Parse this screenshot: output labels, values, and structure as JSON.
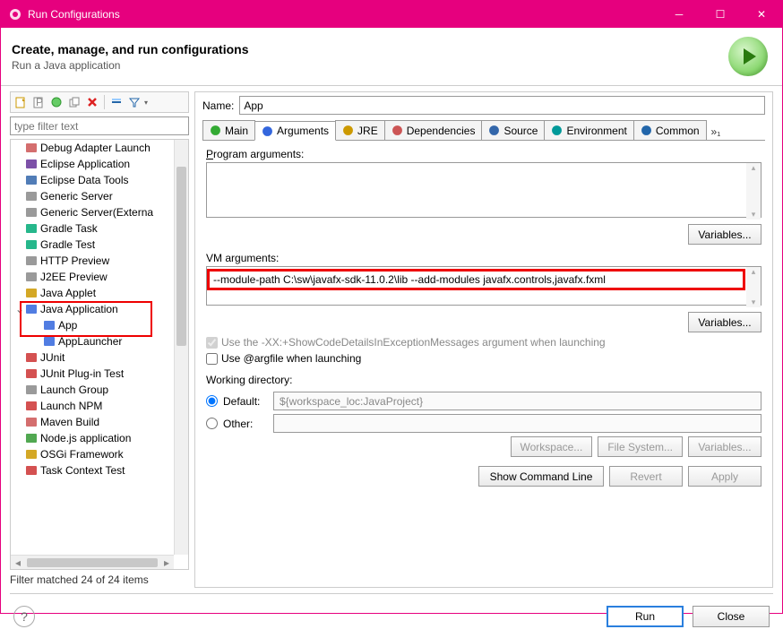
{
  "window": {
    "title": "Run Configurations"
  },
  "header": {
    "title": "Create, manage, and run configurations",
    "subtitle": "Run a Java application"
  },
  "sidebar": {
    "filter_placeholder": "type filter text",
    "items": [
      {
        "label": "Debug Adapter Launch",
        "icon": "bug"
      },
      {
        "label": "Eclipse Application",
        "icon": "eclipse"
      },
      {
        "label": "Eclipse Data Tools",
        "icon": "db"
      },
      {
        "label": "Generic Server",
        "icon": "server"
      },
      {
        "label": "Generic Server(Externa",
        "icon": "server"
      },
      {
        "label": "Gradle Task",
        "icon": "gradle"
      },
      {
        "label": "Gradle Test",
        "icon": "gradle"
      },
      {
        "label": "HTTP Preview",
        "icon": "server"
      },
      {
        "label": "J2EE Preview",
        "icon": "server"
      },
      {
        "label": "Java Applet",
        "icon": "applet"
      },
      {
        "label": "Java Application",
        "icon": "java",
        "expanded": true,
        "children": [
          {
            "label": "App",
            "icon": "java",
            "selected": true
          },
          {
            "label": "AppLauncher",
            "icon": "java"
          }
        ]
      },
      {
        "label": "JUnit",
        "icon": "junit"
      },
      {
        "label": "JUnit Plug-in Test",
        "icon": "junit"
      },
      {
        "label": "Launch Group",
        "icon": "group"
      },
      {
        "label": "Launch NPM",
        "icon": "npm"
      },
      {
        "label": "Maven Build",
        "icon": "maven"
      },
      {
        "label": "Node.js application",
        "icon": "node"
      },
      {
        "label": "OSGi Framework",
        "icon": "osgi"
      },
      {
        "label": "Task Context Test",
        "icon": "junit"
      }
    ],
    "status": "Filter matched 24 of 24 items"
  },
  "main": {
    "name_label": "Name:",
    "name_value": "App",
    "tabs": [
      "Main",
      "Arguments",
      "JRE",
      "Dependencies",
      "Source",
      "Environment",
      "Common"
    ],
    "active_tab": 1,
    "overflow": "»₁",
    "prog_args_label": "Program arguments:",
    "prog_args_value": "",
    "variables_btn": "Variables...",
    "vm_args_label": "VM arguments:",
    "vm_args_value": "--module-path C:\\sw\\javafx-sdk-11.0.2\\lib --add-modules javafx.controls,javafx.fxml",
    "chk_xx": "Use the -XX:+ShowCodeDetailsInExceptionMessages argument when launching",
    "chk_argfile": "Use @argfile when launching",
    "wd_label": "Working directory:",
    "wd_default": "Default:",
    "wd_default_value": "${workspace_loc:JavaProject}",
    "wd_other": "Other:",
    "btn_workspace": "Workspace...",
    "btn_filesystem": "File System...",
    "btn_variables": "Variables...",
    "btn_showcmd": "Show Command Line",
    "btn_revert": "Revert",
    "btn_apply": "Apply"
  },
  "footer": {
    "run": "Run",
    "close": "Close"
  }
}
